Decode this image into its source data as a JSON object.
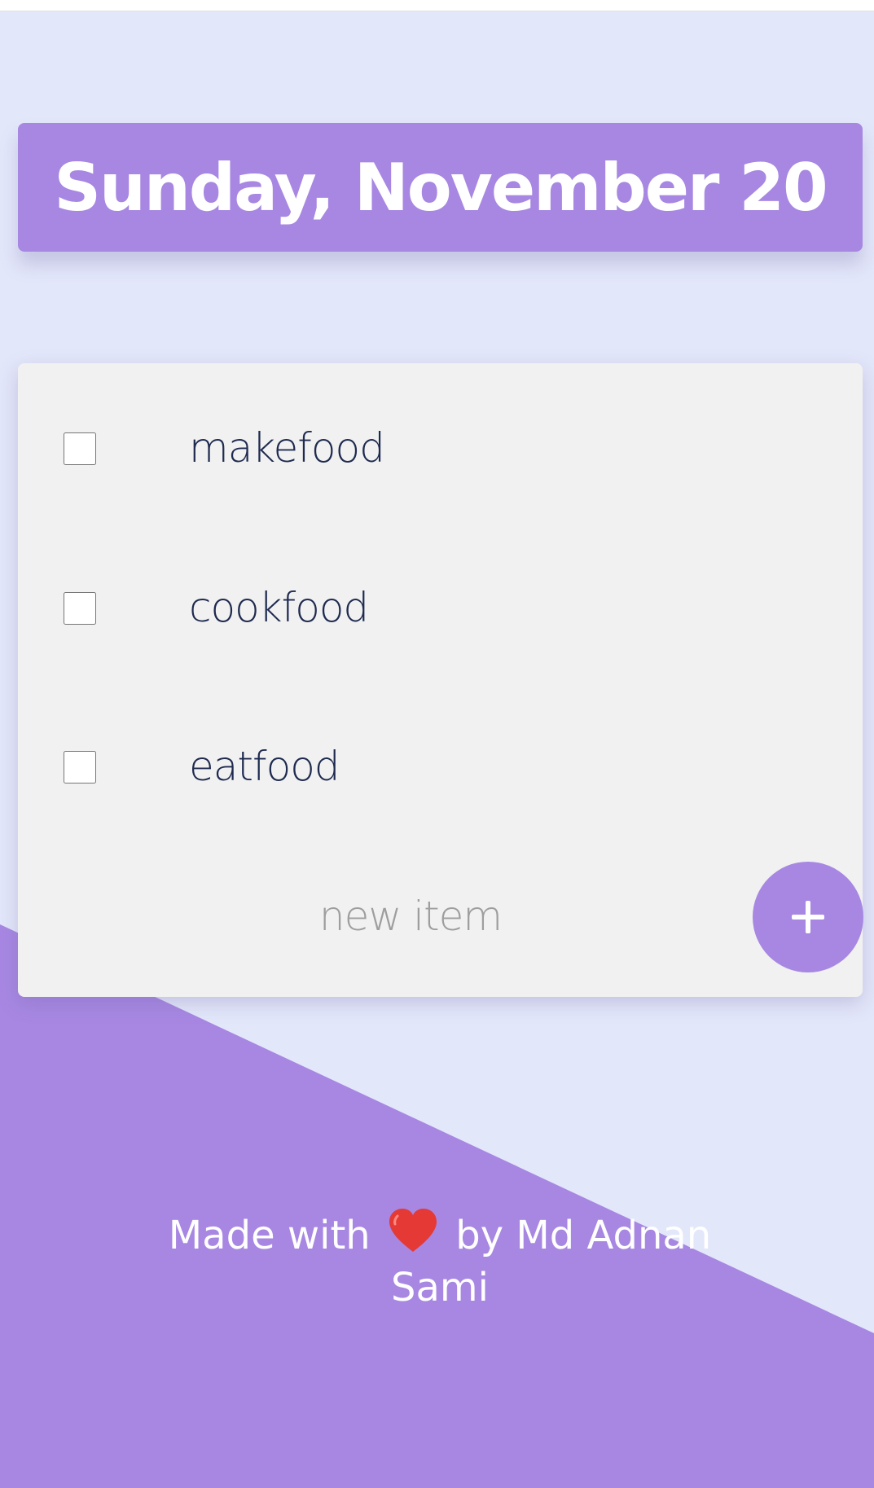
{
  "colors": {
    "background": "#e3e7fa",
    "accent": "#a787e2",
    "card": "#f1f1f1",
    "item_text": "#1e2a4f",
    "heart": "#e53935"
  },
  "header": {
    "date": "Sunday, November 20"
  },
  "todo": {
    "items": [
      {
        "label": "makefood",
        "checked": false
      },
      {
        "label": "cookfood",
        "checked": false
      },
      {
        "label": "eatfood",
        "checked": false
      }
    ],
    "new_item_placeholder": "new item",
    "add_button_icon": "plus-icon"
  },
  "footer": {
    "prefix": "Made with",
    "icon": "heart-icon",
    "suffix": "by Md Adnan Sami"
  }
}
